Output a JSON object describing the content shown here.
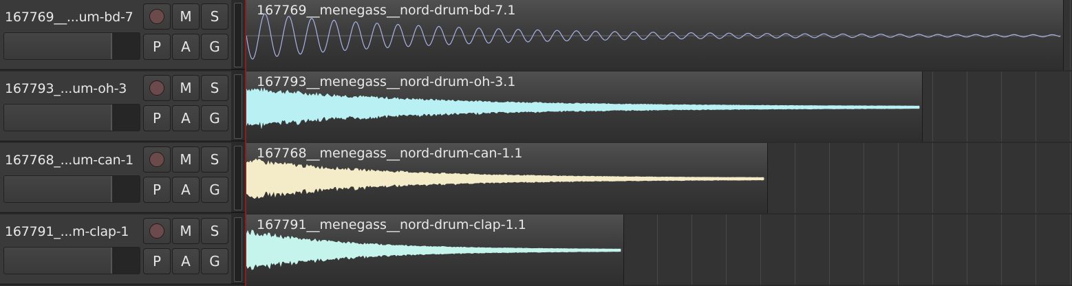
{
  "colors": {
    "header_bg": "#3a3a3a",
    "lane_bg": "#333333",
    "playhead": "#8a2020",
    "record_dot": "#6a4a4a"
  },
  "buttons": {
    "mute": "M",
    "solo": "S",
    "playlist": "P",
    "automation": "A",
    "group": "G"
  },
  "tracks": [
    {
      "name": "167769__...um-bd-7",
      "region_name": "167769__menegass__nord-drum-bd-7.1",
      "wave_color": "#aab4e8",
      "wave_type": "sine-decay"
    },
    {
      "name": "167793_...um-oh-3",
      "region_name": "167793__menegass__nord-drum-oh-3.1",
      "wave_color": "#b8f0f4",
      "wave_type": "noise-decay"
    },
    {
      "name": "167768_...um-can-1",
      "region_name": "167768__menegass__nord-drum-can-1.1",
      "wave_color": "#f4ecc8",
      "wave_type": "noise-decay"
    },
    {
      "name": "167791_...m-clap-1",
      "region_name": "167791__menegass__nord-drum-clap-1.1",
      "wave_color": "#c4f4ec",
      "wave_type": "noise-decay"
    }
  ]
}
